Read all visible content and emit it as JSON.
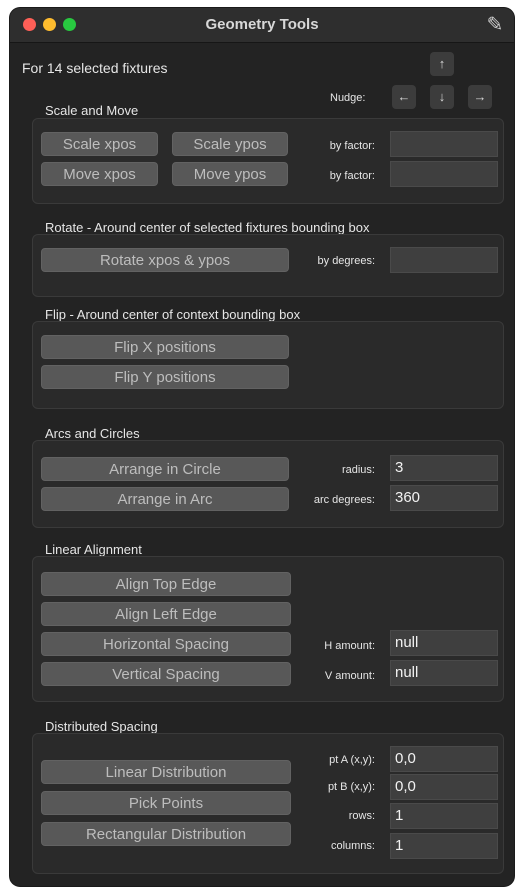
{
  "window": {
    "title": "Geometry Tools"
  },
  "header": {
    "selected_text": "For 14 selected fixtures",
    "nudge_label": "Nudge:"
  },
  "nudge": {
    "up": "↑",
    "left": "←",
    "down": "↓",
    "right": "→"
  },
  "scale_move": {
    "heading": "Scale and Move",
    "scale_xpos": "Scale xpos",
    "scale_ypos": "Scale ypos",
    "move_xpos": "Move xpos",
    "move_ypos": "Move ypos",
    "factor_label_1": "by factor:",
    "factor_label_2": "by factor:",
    "factor_value_1": "",
    "factor_value_2": ""
  },
  "rotate": {
    "heading": "Rotate - Around center of selected fixtures bounding box",
    "button": "Rotate xpos & ypos",
    "degrees_label": "by degrees:",
    "degrees_value": ""
  },
  "flip": {
    "heading": "Flip - Around center of context bounding box",
    "flip_x": "Flip X positions",
    "flip_y": "Flip Y positions"
  },
  "arcs": {
    "heading": "Arcs and Circles",
    "circle": "Arrange in Circle",
    "arc": "Arrange in Arc",
    "radius_label": "radius:",
    "radius_value": "3",
    "arc_label": "arc degrees:",
    "arc_value": "360"
  },
  "linear": {
    "heading": "Linear Alignment",
    "top": "Align Top Edge",
    "left": "Align Left Edge",
    "horizontal": "Horizontal Spacing",
    "vertical": "Vertical Spacing",
    "h_label": "H amount:",
    "h_value": "null",
    "v_label": "V amount:",
    "v_value": "null"
  },
  "distributed": {
    "heading": "Distributed Spacing",
    "linear": "Linear Distribution",
    "pick": "Pick Points",
    "rect": "Rectangular Distribution",
    "pta_label": "pt A (x,y):",
    "pta_value": "0,0",
    "ptb_label": "pt B (x,y):",
    "ptb_value": "0,0",
    "rows_label": "rows:",
    "rows_value": "1",
    "cols_label": "columns:",
    "cols_value": "1"
  }
}
